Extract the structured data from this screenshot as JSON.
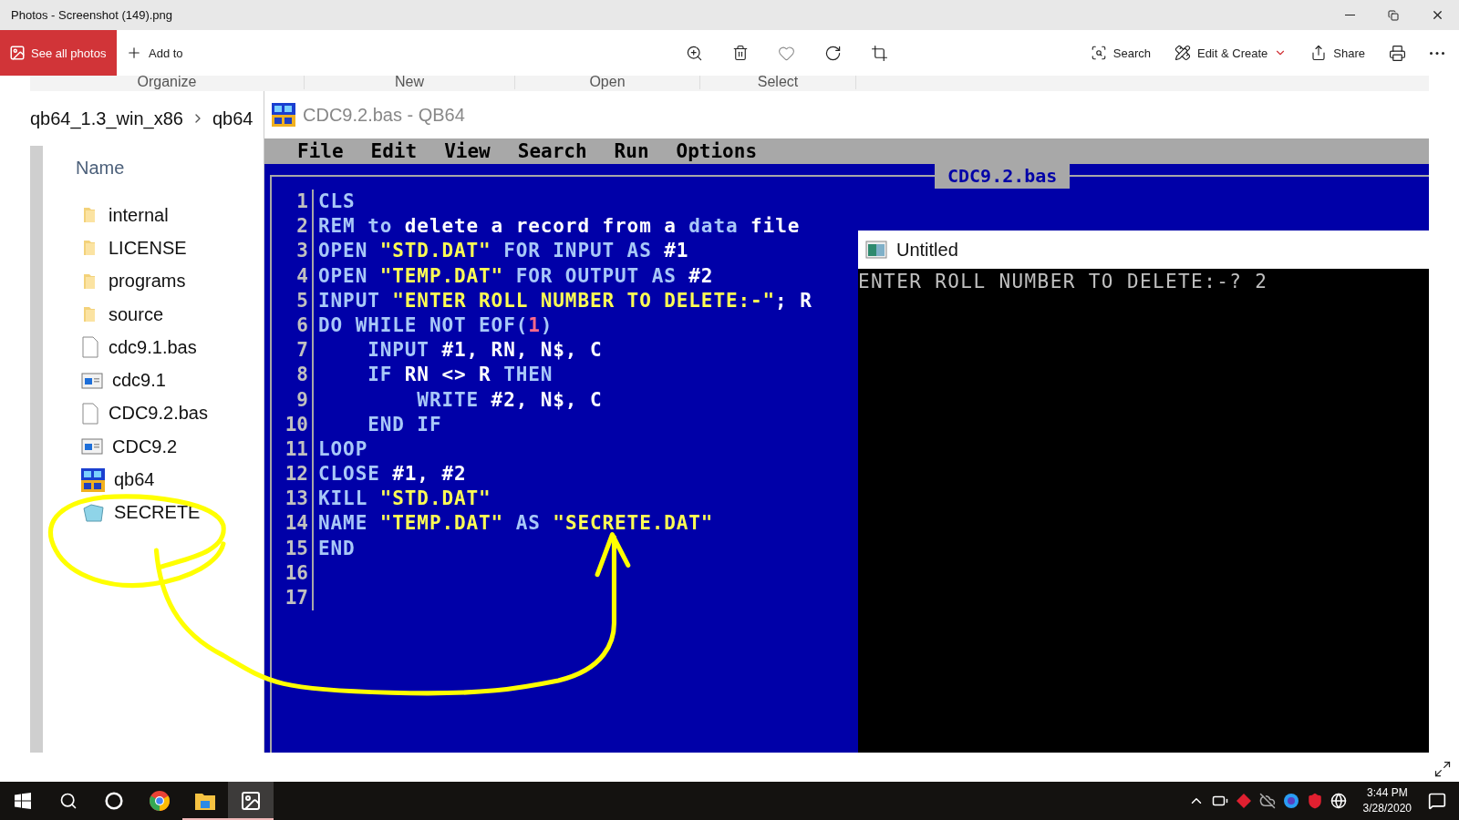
{
  "window": {
    "title": "Photos - Screenshot (149).png"
  },
  "toolbar": {
    "see_all": "See all photos",
    "add_to": "Add to",
    "search": "Search",
    "edit_create": "Edit & Create",
    "share": "Share"
  },
  "explorer": {
    "ribbon": [
      "Organize",
      "New",
      "Open",
      "Select"
    ],
    "breadcrumb": [
      "qb64_1.3_win_x86",
      "qb64"
    ],
    "column_header": "Name",
    "files": [
      {
        "name": "internal",
        "kind": "folder"
      },
      {
        "name": "LICENSE",
        "kind": "folder"
      },
      {
        "name": "programs",
        "kind": "folder"
      },
      {
        "name": "source",
        "kind": "folder"
      },
      {
        "name": "cdc9.1.bas",
        "kind": "text"
      },
      {
        "name": "cdc9.1",
        "kind": "app"
      },
      {
        "name": "CDC9.2.bas",
        "kind": "text"
      },
      {
        "name": "CDC9.2",
        "kind": "app"
      },
      {
        "name": "qb64",
        "kind": "qb64"
      },
      {
        "name": "SECRETE",
        "kind": "data"
      }
    ]
  },
  "qb64": {
    "title": "CDC9.2.bas - QB64",
    "menu": [
      "File",
      "Edit",
      "View",
      "Search",
      "Run",
      "Options"
    ],
    "tab": "CDC9.2.bas",
    "lines": [
      {
        "number": "1",
        "tokens": [
          {
            "kind": "kw",
            "text": "CLS"
          }
        ]
      },
      {
        "number": "2",
        "tokens": [
          {
            "kind": "kw",
            "text": "REM to "
          },
          {
            "kind": "id",
            "text": "delete a record from a "
          },
          {
            "kind": "kw",
            "text": "data"
          },
          {
            "kind": "id",
            "text": " file"
          }
        ]
      },
      {
        "number": "3",
        "tokens": [
          {
            "kind": "kw",
            "text": "OPEN "
          },
          {
            "kind": "str",
            "text": "\"STD.DAT\""
          },
          {
            "kind": "kw",
            "text": " FOR INPUT AS "
          },
          {
            "kind": "id",
            "text": "#1"
          }
        ]
      },
      {
        "number": "4",
        "tokens": [
          {
            "kind": "kw",
            "text": "OPEN "
          },
          {
            "kind": "str",
            "text": "\"TEMP.DAT\""
          },
          {
            "kind": "kw",
            "text": " FOR OUTPUT AS "
          },
          {
            "kind": "id",
            "text": "#2"
          }
        ]
      },
      {
        "number": "5",
        "tokens": [
          {
            "kind": "kw",
            "text": "INPUT "
          },
          {
            "kind": "str",
            "text": "\"ENTER ROLL NUMBER TO DELETE:-\""
          },
          {
            "kind": "id",
            "text": "; R"
          }
        ]
      },
      {
        "number": "6",
        "tokens": [
          {
            "kind": "kw",
            "text": "DO WHILE NOT EOF("
          },
          {
            "kind": "num",
            "text": "1"
          },
          {
            "kind": "kw",
            "text": ")"
          }
        ]
      },
      {
        "number": "7",
        "tokens": [
          {
            "kind": "kw",
            "text": "    INPUT "
          },
          {
            "kind": "id",
            "text": "#1, RN, N$, C"
          }
        ]
      },
      {
        "number": "8",
        "tokens": [
          {
            "kind": "kw",
            "text": "    IF "
          },
          {
            "kind": "id",
            "text": "RN <> R "
          },
          {
            "kind": "kw",
            "text": "THEN"
          }
        ]
      },
      {
        "number": "9",
        "tokens": [
          {
            "kind": "kw",
            "text": "        WRITE "
          },
          {
            "kind": "id",
            "text": "#2, N$, C"
          }
        ]
      },
      {
        "number": "10",
        "tokens": [
          {
            "kind": "kw",
            "text": "    END IF"
          }
        ]
      },
      {
        "number": "11",
        "tokens": [
          {
            "kind": "kw",
            "text": "LOOP"
          }
        ]
      },
      {
        "number": "12",
        "tokens": [
          {
            "kind": "kw",
            "text": "CLOSE "
          },
          {
            "kind": "id",
            "text": "#1, #2"
          }
        ]
      },
      {
        "number": "13",
        "tokens": [
          {
            "kind": "kw",
            "text": "KILL "
          },
          {
            "kind": "str",
            "text": "\"STD.DAT\""
          }
        ]
      },
      {
        "number": "14",
        "tokens": [
          {
            "kind": "kw",
            "text": "NAME "
          },
          {
            "kind": "str",
            "text": "\"TEMP.DAT\""
          },
          {
            "kind": "kw",
            "text": " AS "
          },
          {
            "kind": "str",
            "text": "\"SECRETE.DAT\""
          }
        ]
      },
      {
        "number": "15",
        "tokens": [
          {
            "kind": "kw",
            "text": "END"
          }
        ]
      },
      {
        "number": "16"
      },
      {
        "number": "17"
      }
    ]
  },
  "output_window": {
    "title": "Untitled",
    "text": "ENTER ROLL NUMBER TO DELETE:-? 2"
  },
  "taskbar": {
    "apps": [
      {
        "kind": "start",
        "running": false,
        "selected": false
      },
      {
        "kind": "search",
        "running": false,
        "selected": false
      },
      {
        "kind": "cortana",
        "running": false,
        "selected": false
      },
      {
        "kind": "chrome",
        "running": false,
        "selected": false
      },
      {
        "kind": "explorer",
        "running": true,
        "selected": false
      },
      {
        "kind": "photos",
        "running": true,
        "selected": true
      }
    ],
    "time": "3:44 PM",
    "date": "3/28/2020"
  }
}
